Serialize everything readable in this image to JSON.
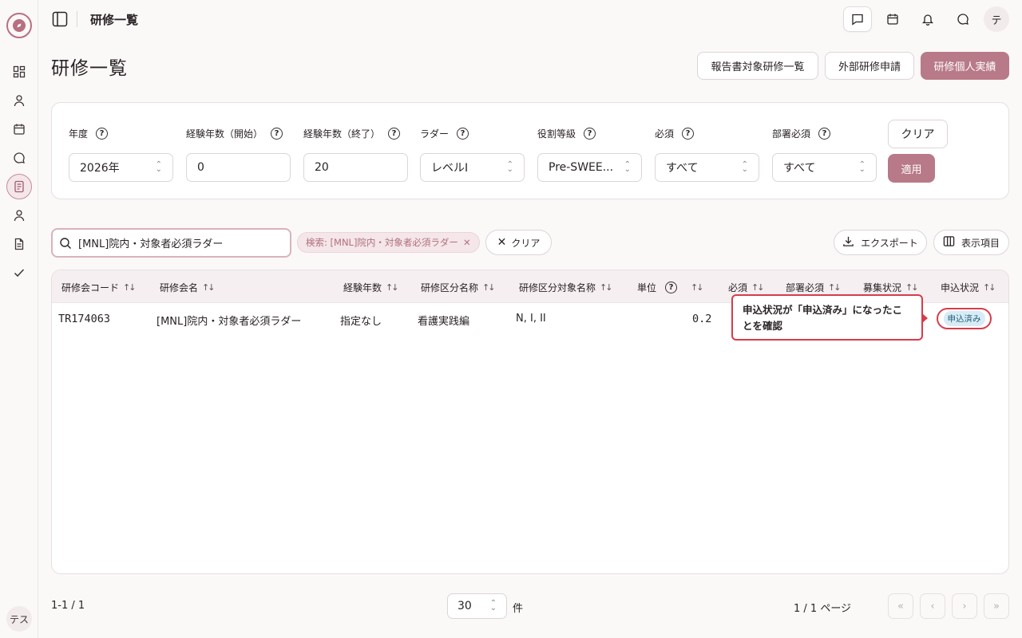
{
  "app": {
    "top_title": "研修一覧",
    "user_initial": "テ",
    "sidebar_user": "テス"
  },
  "page": {
    "title": "研修一覧"
  },
  "header_buttons": {
    "report": "報告書対象研修一覧",
    "external": "外部研修申請",
    "personal": "研修個人実績"
  },
  "filters": {
    "year": {
      "label": "年度",
      "value": "2026年"
    },
    "exp_start": {
      "label": "経験年数（開始）",
      "value": "0"
    },
    "exp_end": {
      "label": "経験年数（終了）",
      "value": "20"
    },
    "ladder": {
      "label": "ラダー",
      "value": "レベルI"
    },
    "grade": {
      "label": "役割等級",
      "value": "Pre-SWEE..."
    },
    "required": {
      "label": "必須",
      "value": "すべて"
    },
    "dept_required": {
      "label": "部署必須",
      "value": "すべて"
    },
    "clear_label": "クリア",
    "apply_label": "適用"
  },
  "toolbar": {
    "search_value": "[MNL]院内・対象者必須ラダー",
    "chip_label": "検索: [MNL]院内・対象者必須ラダー",
    "clear_label": "クリア",
    "export_label": "エクスポート",
    "columns_label": "表示項目"
  },
  "table": {
    "headers": {
      "code": "研修会コード",
      "name": "研修会名",
      "exp": "経験年数",
      "category": "研修区分名称",
      "target": "研修区分対象名称",
      "unit": "単位",
      "required": "必須",
      "dept_required": "部署必須",
      "recruit": "募集状況",
      "apply": "申込状況"
    },
    "rows": [
      {
        "code": "TR174063",
        "name": "[MNL]院内・対象者必須ラダー",
        "exp": "指定なし",
        "category": "看護実践編",
        "target": "N, I, II",
        "unit": "0.2",
        "apply": "申込済み"
      }
    ]
  },
  "callout": {
    "text": "申込状況が「申込済み」になったことを確認"
  },
  "pagination": {
    "count": "1-1 / 1",
    "per_page": "30",
    "per_page_unit": "件",
    "page_info": "1 / 1 ページ"
  },
  "colors": {
    "accent": "#b87a88",
    "highlight": "#d63c4a"
  }
}
